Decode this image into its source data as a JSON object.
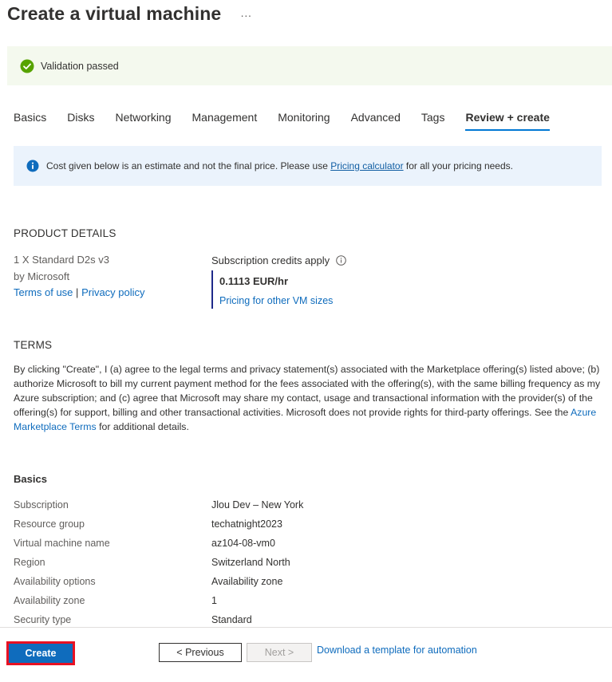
{
  "header": {
    "title": "Create a virtual machine",
    "more_label": "···"
  },
  "validation": {
    "text": "Validation passed",
    "color": "#57a300"
  },
  "tabs": [
    {
      "label": "Basics"
    },
    {
      "label": "Disks"
    },
    {
      "label": "Networking"
    },
    {
      "label": "Management"
    },
    {
      "label": "Monitoring"
    },
    {
      "label": "Advanced"
    },
    {
      "label": "Tags"
    },
    {
      "label": "Review + create",
      "active": true
    }
  ],
  "info_banner": {
    "text_before": "Cost given below is an estimate and not the final price. Please use ",
    "link": "Pricing calculator",
    "text_after": " for all your pricing needs."
  },
  "product_details": {
    "heading": "PRODUCT DETAILS",
    "product": "1 X Standard D2s v3",
    "publisher": "by Microsoft",
    "terms_link": "Terms of use",
    "separator": "|",
    "privacy_link": "Privacy policy",
    "credits_label": "Subscription credits apply",
    "price": "0.1113 EUR/hr",
    "pricing_link": "Pricing for other VM sizes"
  },
  "terms": {
    "heading": "TERMS",
    "text_before": "By clicking \"Create\", I (a) agree to the legal terms and privacy statement(s) associated with the Marketplace offering(s) listed above; (b) authorize Microsoft to bill my current payment method for the fees associated with the offering(s), with the same billing frequency as my Azure subscription; and (c) agree that Microsoft may share my contact, usage and transactional information with the provider(s) of the offering(s) for support, billing and other transactional activities. Microsoft does not provide rights for third-party offerings. See the ",
    "link": "Azure Marketplace Terms",
    "text_after": " for additional details."
  },
  "basics": {
    "heading": "Basics",
    "rows": [
      {
        "key": "Subscription",
        "value": "Jlou Dev – New York"
      },
      {
        "key": "Resource group",
        "value": "techatnight2023"
      },
      {
        "key": "Virtual machine name",
        "value": "az104-08-vm0"
      },
      {
        "key": "Region",
        "value": "Switzerland North"
      },
      {
        "key": "Availability options",
        "value": "Availability zone"
      },
      {
        "key": "Availability zone",
        "value": "1"
      },
      {
        "key": "Security type",
        "value": "Standard"
      }
    ]
  },
  "footer": {
    "create_label": "Create",
    "previous_label": "< Previous",
    "next_label": "Next >",
    "download_link": "Download a template for automation"
  },
  "colors": {
    "accent": "#0f6cbd",
    "highlight_border": "#e81123",
    "info_bg": "#ebf3fc",
    "success_bg": "#f4f9ee"
  }
}
